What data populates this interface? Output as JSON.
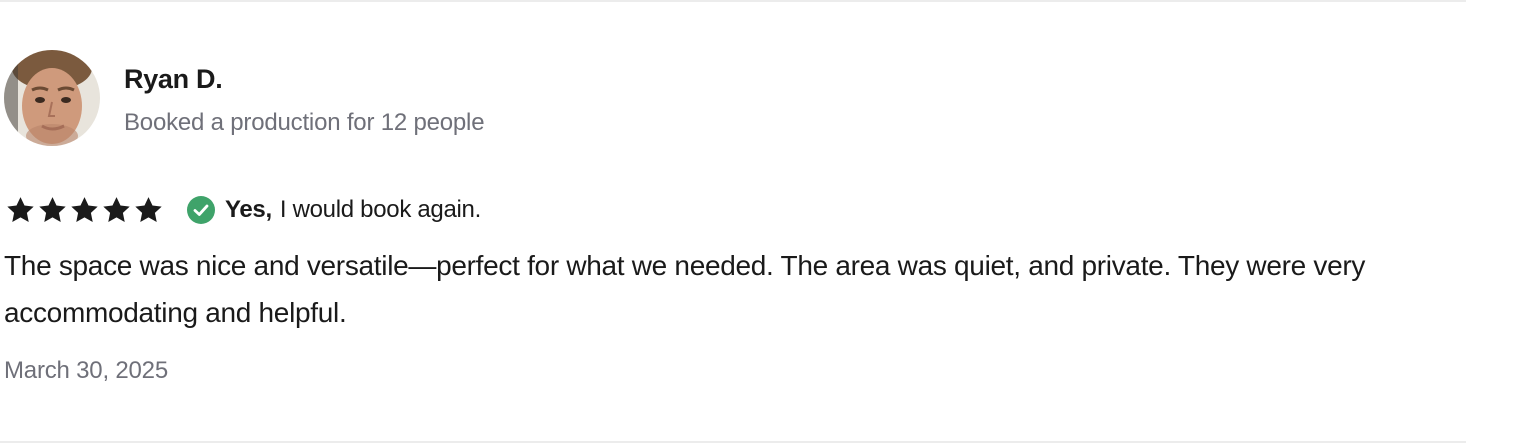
{
  "review": {
    "reviewer_name": "Ryan D.",
    "booking_info": "Booked a production for 12 people",
    "rating_value": 5,
    "rating_max": 5,
    "rebook_yes": "Yes,",
    "rebook_text": "I would book again.",
    "body": "The space was nice and versatile—perfect for what we needed. The area was quiet, and private. They were very accommodating and helpful.",
    "date": "March 30, 2025"
  },
  "icons": {
    "star": "star-icon",
    "check": "check-circle-icon"
  },
  "colors": {
    "text": "#1a1a1a",
    "muted": "#6f7079",
    "check_green": "#3fa36a",
    "divider": "#ececec"
  }
}
